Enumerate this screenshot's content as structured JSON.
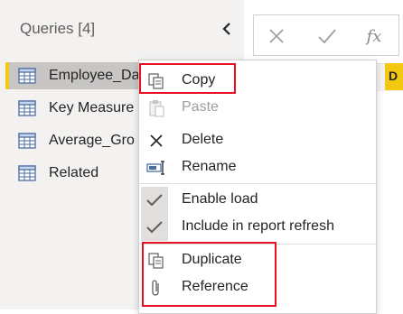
{
  "queries_pane": {
    "title": "Queries [4]",
    "items": [
      {
        "label": "Employee_Da",
        "selected": true
      },
      {
        "label": "Key Measure",
        "selected": false
      },
      {
        "label": "Average_Gro",
        "selected": false
      },
      {
        "label": "Related",
        "selected": false
      }
    ]
  },
  "formula_bar": {
    "cancel_icon": "x-icon",
    "confirm_icon": "check-icon",
    "fx_label": "fx"
  },
  "grid": {
    "header_fragment": "D",
    "accent_color": "#f2c811"
  },
  "context_menu": {
    "copy": "Copy",
    "paste": "Paste",
    "delete": "Delete",
    "rename": "Rename",
    "enable_load": "Enable load",
    "include_refresh": "Include in report refresh",
    "duplicate": "Duplicate",
    "reference": "Reference"
  },
  "highlight_color": "#e81123"
}
